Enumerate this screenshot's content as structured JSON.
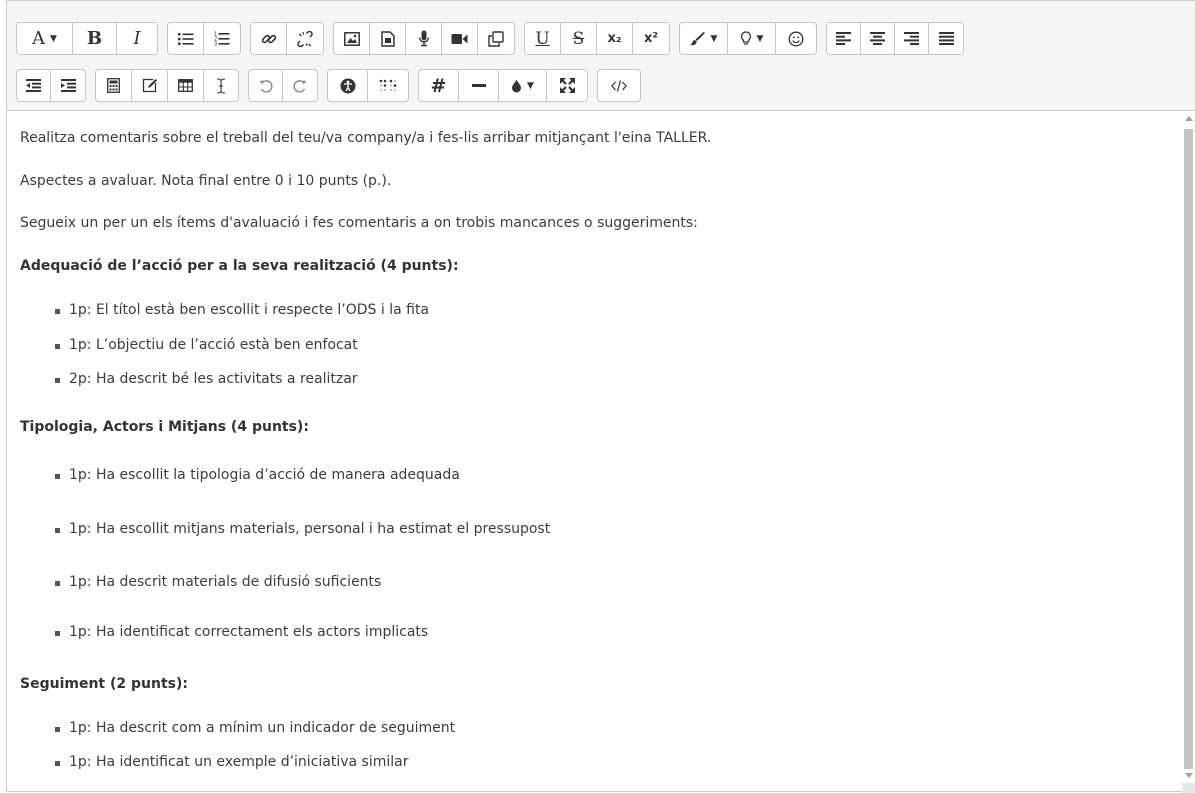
{
  "toolbar": {
    "font_label": "A",
    "bold_label": "B",
    "italic_label": "I",
    "underline_label": "U",
    "strike_label": "S",
    "subscript_label": "x₂",
    "superscript_label": "x²",
    "hash_label": "#"
  },
  "content": {
    "intro": "Realitza comentaris sobre el treball del teu/va company/a i fes-lis arribar mitjançant l'eina TALLER.",
    "aspects": "Aspectes a avaluar. Nota final entre 0 i 10 punts (p.).",
    "follow": "Segueix un per un els ítems d'avaluació i fes comentaris a on trobis mancances o suggeriments:",
    "section1": {
      "title": "Adequació de l’acció per a la seva realització (4 punts):",
      "items": [
        "1p: El títol està ben escollit i respecte l’ODS i la fita",
        "1p: L’objectiu de l’acció està ben enfocat",
        "2p: Ha descrit bé les activitats a realitzar"
      ]
    },
    "section2": {
      "title": "Tipologia, Actors i Mitjans (4 punts):",
      "items": [
        "1p: Ha escollit la tipologia d’acció de manera adequada",
        "1p: Ha escollit mitjans materials, personal i ha estimat el pressupost",
        "1p: Ha descrit materials de difusió suficients",
        "1p: Ha identificat correctament els actors implicats"
      ]
    },
    "section3": {
      "title": "Seguiment (2 punts):",
      "items": [
        "1p: Ha descrit com a mínim un indicador de seguiment",
        "1p: Ha identificat un exemple d’iniciativa similar"
      ]
    }
  }
}
